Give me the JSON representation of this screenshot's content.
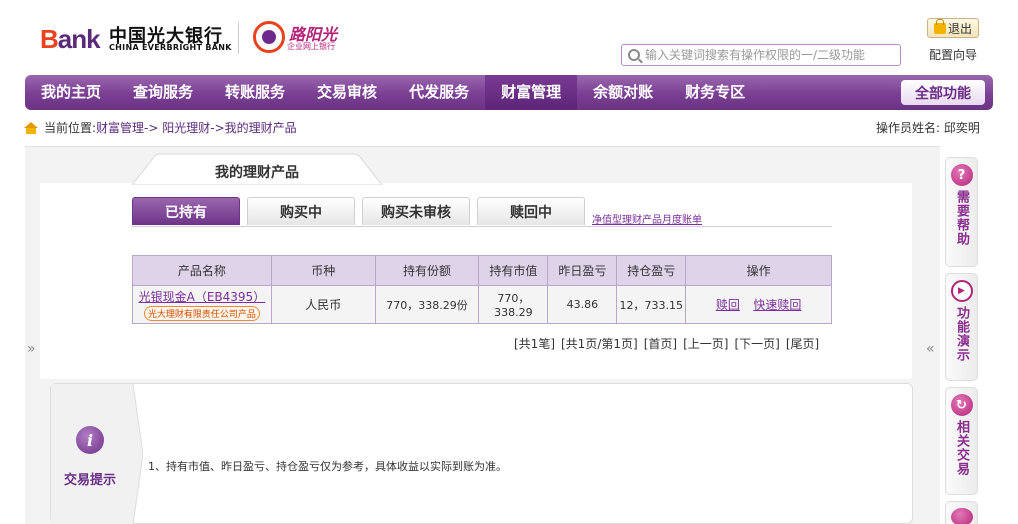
{
  "header": {
    "bank_logo_prefix": "B",
    "bank_logo_word": "ank",
    "bank_name_cn": "中国光大银行",
    "bank_name_en": "CHINA EVERBRIGHT BANK",
    "sub_brand": "阳光",
    "sub_brand_prefix": "路",
    "sub_brand_caption": "企业网上银行",
    "logout_label": "退出",
    "search_placeholder": "输入关键词搜索有操作权限的一/二级功能",
    "config_label": "配置向导"
  },
  "nav": {
    "items": [
      "我的主页",
      "查询服务",
      "转账服务",
      "交易审核",
      "代发服务",
      "财富管理",
      "余额对账",
      "财务专区"
    ],
    "active_index": 5,
    "all_label": "全部功能"
  },
  "breadcrumb": {
    "label": "当前位置:",
    "path": "财富管理-> 阳光理财->我的理财产品",
    "operator_label": "操作员姓名:",
    "operator_name": "邱奕明"
  },
  "page": {
    "title": "我的理财产品",
    "tabs": [
      "已持有",
      "购买中",
      "购买未审核",
      "赎回中"
    ],
    "active_tab": 0,
    "statement_link": "净值型理财产品月度账单"
  },
  "table": {
    "headers": [
      "产品名称",
      "币种",
      "持有份额",
      "持有市值",
      "昨日盈亏",
      "持仓盈亏",
      "操作"
    ],
    "rows": [
      {
        "name": "光银现金A（EB4395）",
        "badge": "光大理财有限责任公司产品",
        "currency": "人民币",
        "shares": "770，338.29份",
        "market_value": "770，338.29",
        "daily_pnl": "43.86",
        "position_pnl": "12，733.15",
        "actions": [
          "赎回",
          "快速赎回"
        ]
      }
    ]
  },
  "pager": {
    "total": "[共1笔]",
    "pages": "[共1页/第1页]",
    "first": "[首页]",
    "prev": "[上一页]",
    "next": "[下一页]",
    "last": "[尾页]"
  },
  "arrows": {
    "left": "»",
    "right": "«"
  },
  "tips": {
    "label": "交易提示",
    "icon_glyph": "i",
    "text": "1、持有市值、昨日盈亏、持仓盈亏仅为参考，具体收益以实际到账为准。"
  },
  "sidebar": {
    "items": [
      {
        "icon": "?",
        "label": "需要帮助"
      },
      {
        "icon": "▶",
        "label": "功能演示"
      },
      {
        "icon": "↻",
        "label": "相关交易"
      }
    ]
  },
  "colors": {
    "brand_purple": "#7a3f93",
    "link_purple": "#7a2e9a",
    "logo_orange": "#e8431e"
  }
}
